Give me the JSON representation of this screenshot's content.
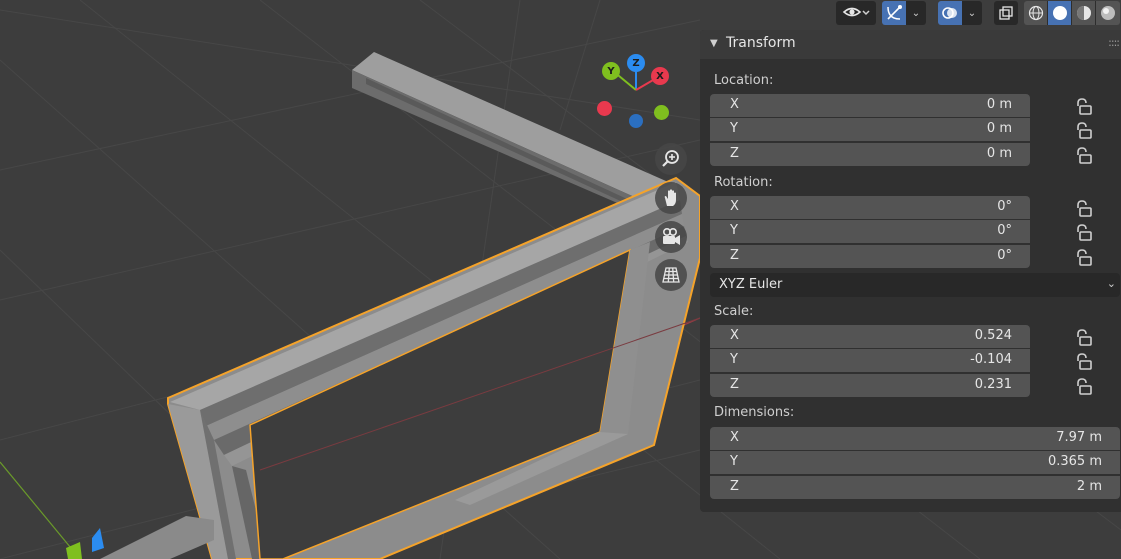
{
  "colors": {
    "background": "#3d3d3d",
    "panel": "#303030",
    "field": "#545454",
    "selection_outline": "#f5a32a",
    "active_button": "#4772b3",
    "axis_x": "#e8394e",
    "axis_y": "#7fbf1f",
    "axis_z": "#2b8cf0"
  },
  "header": {
    "visibility_icon": "eye-icon",
    "gizmo_icon": "gizmo-icon",
    "overlay_icon": "overlays-icon",
    "xray_icon": "xray-icon",
    "shading_modes": [
      "wireframe-icon",
      "solid-icon",
      "material-preview-icon",
      "rendered-icon"
    ],
    "active_shading": "solid-icon"
  },
  "navigation_gizmo": {
    "axes": {
      "x": "X",
      "y": "Y",
      "z": "Z"
    },
    "tools": [
      "zoom-icon",
      "pan-icon",
      "camera-icon",
      "grid-icon"
    ]
  },
  "panel": {
    "title": "Transform",
    "location": {
      "label": "Location:",
      "x": {
        "label": "X",
        "value": "0 m"
      },
      "y": {
        "label": "Y",
        "value": "0 m"
      },
      "z": {
        "label": "Z",
        "value": "0 m"
      }
    },
    "rotation": {
      "label": "Rotation:",
      "x": {
        "label": "X",
        "value": "0°"
      },
      "y": {
        "label": "Y",
        "value": "0°"
      },
      "z": {
        "label": "Z",
        "value": "0°"
      },
      "mode": "XYZ Euler"
    },
    "scale": {
      "label": "Scale:",
      "x": {
        "label": "X",
        "value": "0.524"
      },
      "y": {
        "label": "Y",
        "value": "-0.104"
      },
      "z": {
        "label": "Z",
        "value": "0.231"
      }
    },
    "dimensions": {
      "label": "Dimensions:",
      "x": {
        "label": "X",
        "value": "7.97 m"
      },
      "y": {
        "label": "Y",
        "value": "0.365 m"
      },
      "z": {
        "label": "Z",
        "value": "2 m"
      }
    }
  }
}
